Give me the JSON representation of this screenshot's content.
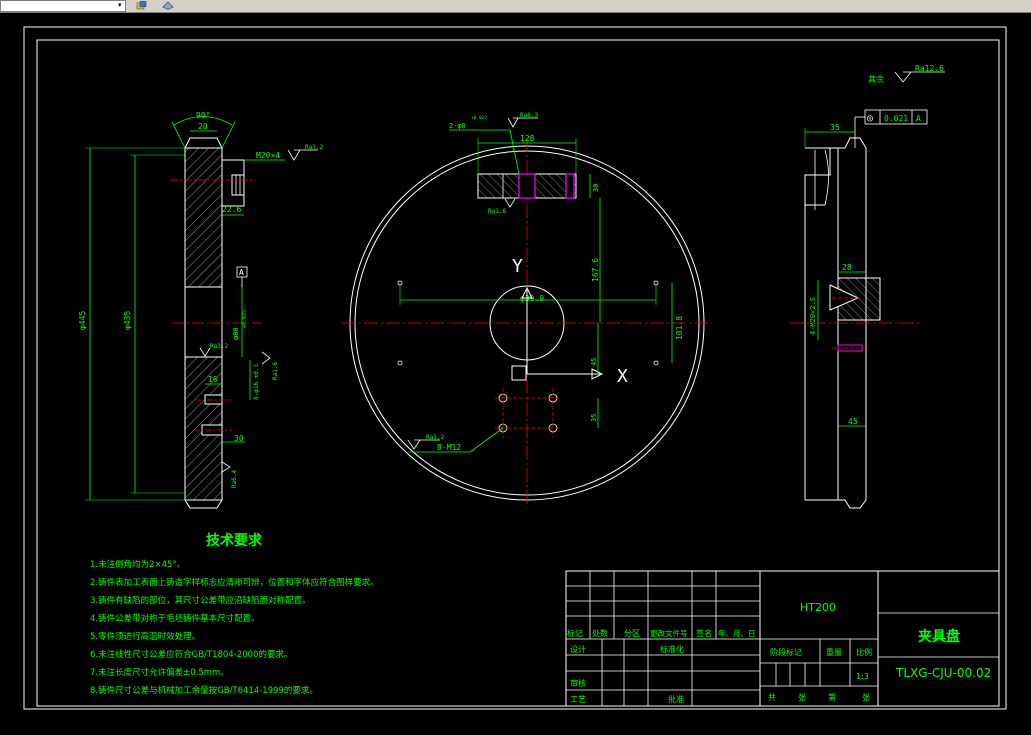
{
  "window": {
    "dropdown_arrow": "▾",
    "toolbar_icons": [
      "layer-tool-icon",
      "properties-icon"
    ]
  },
  "colors": {
    "background": "#000000",
    "lines": "#ffffff",
    "dimensions": "#00ff00",
    "hatch": "#ffffff",
    "centerlines": "#ff0000",
    "holes": "#ff00ff"
  },
  "left_view": {
    "angle": "90°",
    "width_top": "20",
    "thread": "M20×4",
    "depth": "22.6",
    "datum": "A",
    "dia_outer": "φ445",
    "dia_inner": "φ435",
    "bore": "φ80",
    "tol": "+0.035",
    "rough_top": "Ra3.2",
    "rough_mid": "Ra3.2",
    "rough_side": "Ra1.6",
    "rough_bottom": "Ra6.4",
    "dim_16": "16",
    "dim_30": "30",
    "hole_spec": "8-φ16 ±0.1"
  },
  "center_view": {
    "hole_count": "2-φ8",
    "hole_tol": "+0.022",
    "rough_top": "Ra6.3",
    "rough_left": "Ra1.6",
    "dim_128": "128",
    "dim_30": "30",
    "dim_167": "167.6",
    "dim_101": "101.8",
    "dim_45": "45",
    "dim_35": "35",
    "center_dia": "φ39.9",
    "axis_y": "Y",
    "axis_x": "X",
    "thread_note": "8-M12",
    "rough_thread": "Ra3.2"
  },
  "right_view": {
    "rough_rest": "其余",
    "rough_rest_value": "Ra12.6",
    "flatness_symbol": "◎",
    "flatness_value": "0.021",
    "flatness_datum": "A",
    "dim_35": "35",
    "dim_28": "28",
    "thread": "4-M20×2.5",
    "dim_45": "45"
  },
  "notes": {
    "title": "技术要求",
    "items": [
      "1.未注倒角均为2×45°。",
      "2.铸件表加工表面上铸造字样标志应清晰可辨，位置和字体应符合图样要求。",
      "3.铸件有缺陷的部位，其尺寸公差带应沿缺陷面对称配置。",
      "4.铸件公差带对称于毛坯铸件基本尺寸配置。",
      "5.零件须进行高温时效处理。",
      "6.未注线性尺寸公差应符合GB/T1804-2000的要求。",
      "7.未注长度尺寸允许偏差±0.5mm。",
      "8.铸件尺寸公差与机械加工余量按GB/T6414-1999的要求。"
    ]
  },
  "title_block": {
    "material": "HT200",
    "part_name": "夹具盘",
    "drawing_no": "TLXG-CJU-00.02",
    "labels": {
      "mark": "标记",
      "count": "处数",
      "zone": "分区",
      "doc_no": "更改文件号",
      "sign": "签名",
      "date": "年、月、日",
      "design": "设计",
      "standard": "标准化",
      "stage": "阶段标记",
      "weight": "重量",
      "scale": "比例",
      "scale_value": "1:3",
      "review": "审核",
      "process": "工艺",
      "approve": "批准",
      "total": "共",
      "sheets": "张",
      "page": "第",
      "sheet": "张"
    }
  }
}
